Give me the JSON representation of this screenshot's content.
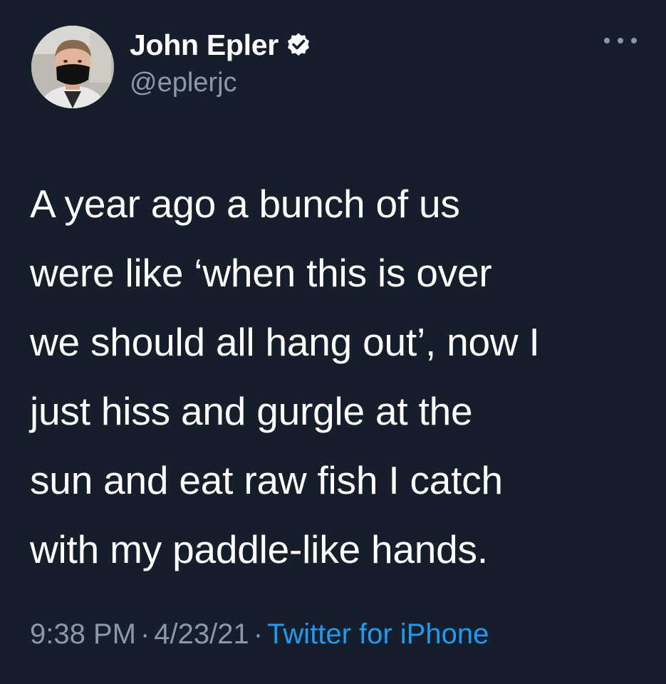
{
  "author": {
    "display_name": "John Epler",
    "handle": "@eplerjc",
    "verified": true
  },
  "tweet": {
    "lines": [
      "A year ago a bunch of us",
      "were like ‘when this is over",
      "we should all hang out’, now I",
      "just hiss and gurgle at the",
      "sun and eat raw fish I catch",
      "with my paddle-like hands."
    ]
  },
  "meta": {
    "time": "9:38 PM",
    "separator": "·",
    "date": "4/23/21",
    "source": "Twitter for iPhone"
  },
  "icons": {
    "verified": "verified-badge-icon",
    "more": "more-options-icon"
  },
  "colors": {
    "background": "#161e2b",
    "text": "#ffffff",
    "secondary": "#8b98a5",
    "link": "#1d9bf0"
  }
}
